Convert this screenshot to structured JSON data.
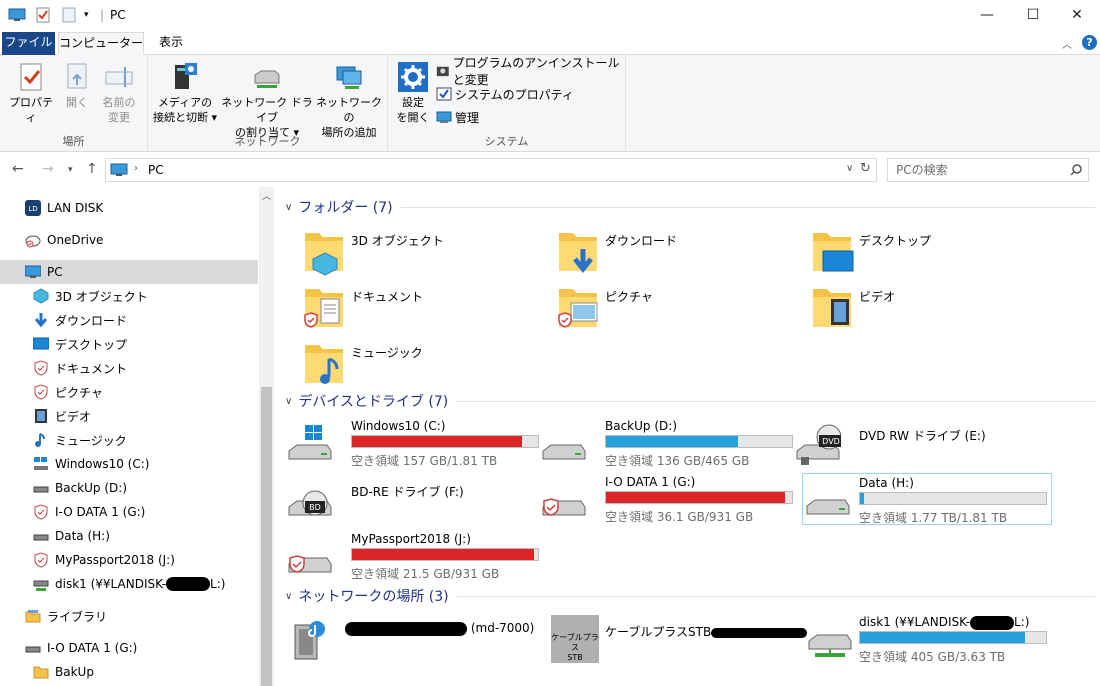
{
  "title": "PC",
  "colors": {
    "bar_red": "#da2626",
    "bar_blue": "#26a0da",
    "file_tab": "#19478a",
    "section": "#1e3287"
  },
  "tabs": {
    "file": "ファイル",
    "computer": "コンピューター",
    "view": "表示"
  },
  "ribbon": {
    "properties": "プロパティ",
    "open": "開く",
    "rename_1": "名前の",
    "rename_2": "変更",
    "group_location": "場所",
    "media_1": "メディアの",
    "media_2": "接続と切断",
    "map_1": "ネットワーク ドライブ",
    "map_2": "の割り当て",
    "addnet_1": "ネットワークの",
    "addnet_2": "場所の追加",
    "group_network": "ネットワーク",
    "settings_1": "設定",
    "settings_2": "を開く",
    "uninstall": "プログラムのアンインストールと変更",
    "sysprop": "システムのプロパティ",
    "manage": "管理",
    "group_system": "システム"
  },
  "address": {
    "path": "PC",
    "search_placeholder": "PCの検索"
  },
  "nav": {
    "landisk": "LAN DISK",
    "onedrive": "OneDrive",
    "pc": "PC",
    "obj3d": "3D オブジェクト",
    "download": "ダウンロード",
    "desktop": "デスクトップ",
    "documents": "ドキュメント",
    "pictures": "ピクチャ",
    "videos": "ビデオ",
    "music": "ミュージック",
    "win10": "Windows10 (C:)",
    "backup": "BackUp (D:)",
    "iodata": "I-O DATA 1 (G:)",
    "data": "Data (H:)",
    "mypassport": "MyPassport2018 (J:)",
    "disk1_pre": "disk1 (¥¥LANDISK-",
    "disk1_post": "L:)",
    "library": "ライブラリ",
    "iodata2": "I-O DATA 1 (G:)",
    "bakup": "BakUp"
  },
  "sections": {
    "folders": "フォルダー (7)",
    "devices": "デバイスとドライブ (7)",
    "network": "ネットワークの場所 (3)"
  },
  "folders": {
    "obj3d": "3D オブジェクト",
    "download": "ダウンロード",
    "desktop": "デスクトップ",
    "documents": "ドキュメント",
    "pictures": "ピクチャ",
    "videos": "ビデオ",
    "music": "ミュージック"
  },
  "drives": {
    "c": {
      "name": "Windows10 (C:)",
      "free": "空き領域 157 GB/1.81 TB",
      "used_fraction": 0.915,
      "color": "#da2626"
    },
    "d": {
      "name": "BackUp (D:)",
      "free": "空き領域 136 GB/465 GB",
      "used_fraction": 0.708,
      "color": "#26a0da"
    },
    "e": {
      "name": "DVD RW ドライブ (E:)"
    },
    "f": {
      "name": "BD-RE ドライブ (F:)"
    },
    "g": {
      "name": "I-O DATA 1 (G:)",
      "free": "空き領域 36.1 GB/931 GB",
      "used_fraction": 0.961,
      "color": "#da2626"
    },
    "h": {
      "name": "Data (H:)",
      "free": "空き領域 1.77 TB/1.81 TB",
      "used_fraction": 0.022,
      "color": "#26a0da"
    },
    "j": {
      "name": "MyPassport2018 (J:)",
      "free": "空き領域 21.5 GB/931 GB",
      "used_fraction": 0.977,
      "color": "#da2626"
    }
  },
  "network": {
    "md7000": "(md-7000)",
    "cableplus": "ケーブルプラスSTB",
    "cable_icon_1": "ケーブルプラス",
    "cable_icon_2": "STB",
    "disk1_pre": "disk1 (¥¥LANDISK-",
    "disk1_post": "L:)",
    "disk1_free": "空き領域 405 GB/3.63 TB",
    "disk1_used_fraction": 0.888,
    "disk1_color": "#26a0da"
  }
}
